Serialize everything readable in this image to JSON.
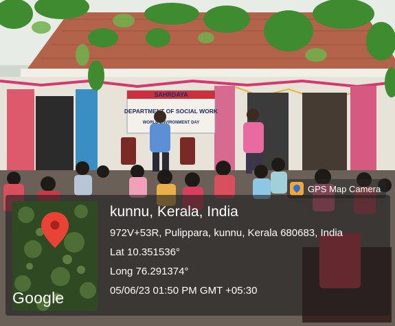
{
  "banner": {
    "college_line": "SAHRDAYA",
    "department_line": "DEPARTMENT OF SOCIAL WORK",
    "event_line": "WORLD ENVIRONMENT DAY"
  },
  "gps_tag": {
    "icon": "gps-map-camera-icon",
    "label": "GPS Map Camera"
  },
  "location": {
    "place": "kunnu, Kerala, India",
    "address": "972V+53R, Pulippara, kunnu, Kerala 680683, India",
    "latitude": "Lat 10.351536°",
    "longitude": "Long 76.291374°",
    "datetime": "05/06/23 01:50 PM GMT +05:30"
  },
  "map": {
    "brand": "Google",
    "pin_icon": "map-pin-icon",
    "pin_color": "#e94335"
  }
}
